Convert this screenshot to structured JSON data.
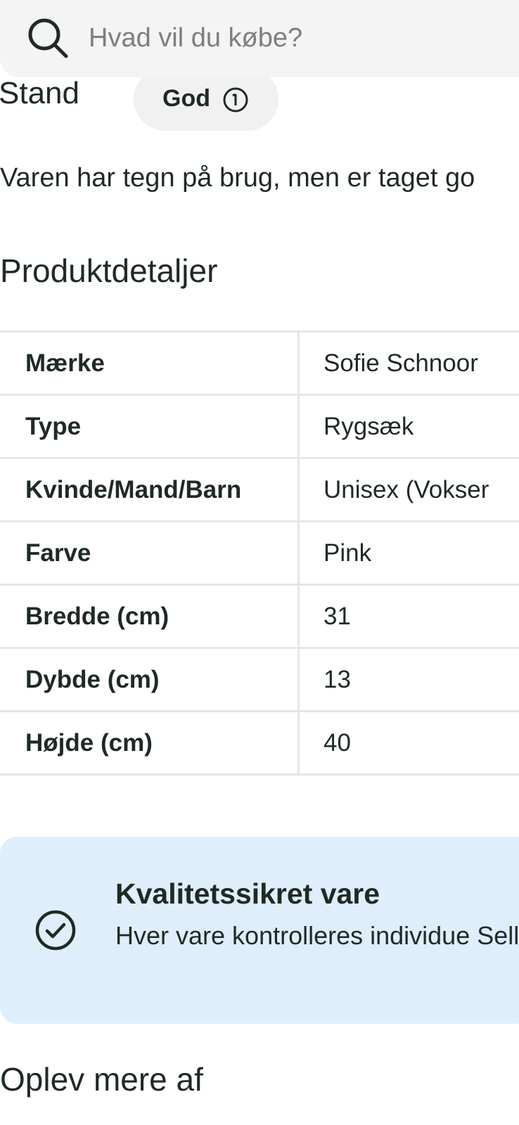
{
  "search": {
    "placeholder": "Hvad vil du købe?"
  },
  "condition": {
    "label": "Stand",
    "value": "God"
  },
  "description": "Varen har tegn på brug, men er taget go",
  "details": {
    "heading": "Produktdetaljer",
    "rows": [
      {
        "key": "Mærke",
        "value": "Sofie Schnoor"
      },
      {
        "key": "Type",
        "value": "Rygsæk"
      },
      {
        "key": "Kvinde/Mand/Barn",
        "value": "Unisex (Vokser"
      },
      {
        "key": "Farve",
        "value": "Pink"
      },
      {
        "key": "Bredde (cm)",
        "value": "31"
      },
      {
        "key": "Dybde (cm)",
        "value": "13"
      },
      {
        "key": "Højde (cm)",
        "value": "40"
      }
    ]
  },
  "quality": {
    "title": "Kvalitetssikret vare",
    "text": "Hver vare kontrolleres individue Sellpy",
    "icon": "check-circle-icon"
  },
  "more": {
    "heading": "Oplev mere af"
  },
  "colors": {
    "text": "#1f2a24",
    "search_bg": "#f3f4f3",
    "pill_bg": "#f0f1f0",
    "table_border": "#e6e7e6",
    "quality_bg": "#dfeefb"
  }
}
